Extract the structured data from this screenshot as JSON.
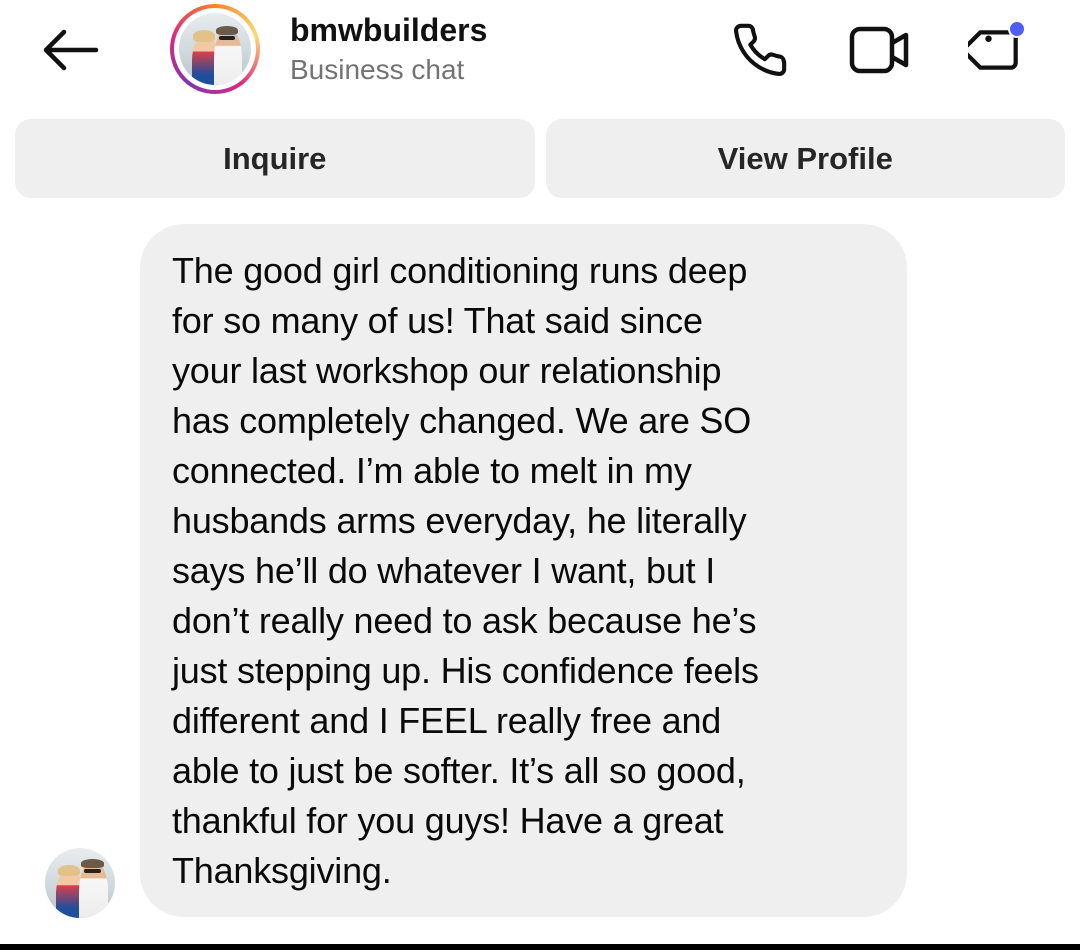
{
  "header": {
    "username": "bmwbuilders",
    "subtitle": "Business chat",
    "icons": {
      "back": "arrow-left-icon",
      "call": "phone-icon",
      "video": "video-camera-icon",
      "tag": "tag-icon"
    },
    "notification_color": "#4f5df5"
  },
  "actions": {
    "inquire_label": "Inquire",
    "view_profile_label": "View Profile"
  },
  "message": {
    "text": "The good girl conditioning runs deep\nfor so many of us! That said since\nyour last workshop our relationship\nhas completely changed. We are SO\nconnected. I’m able to melt in my\nhusbands arms everyday, he literally\nsays he’ll do whatever I want, but I\ndon’t really need to ask because he’s\njust stepping up. His confidence feels\ndifferent and I FEEL really free and\nable to just be softer. It’s all so good,\nthankful for you guys! Have a great\nThanksgiving."
  },
  "colors": {
    "bubble_bg": "#efefef",
    "button_bg": "#efefef",
    "subtitle": "#737373"
  }
}
